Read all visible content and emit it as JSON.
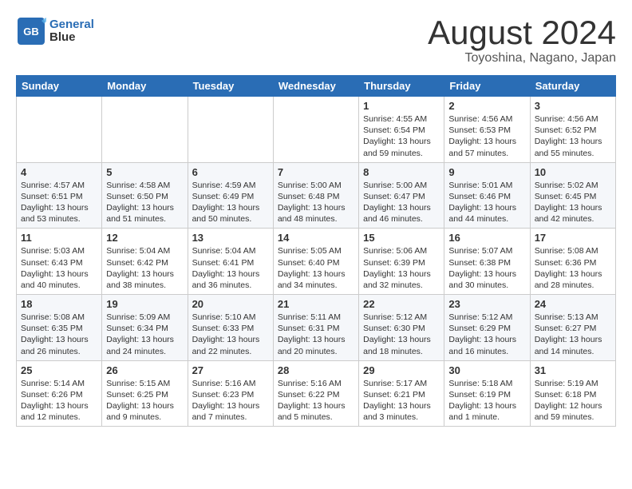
{
  "header": {
    "logo_line1": "General",
    "logo_line2": "Blue",
    "month_title": "August 2024",
    "location": "Toyoshina, Nagano, Japan"
  },
  "weekdays": [
    "Sunday",
    "Monday",
    "Tuesday",
    "Wednesday",
    "Thursday",
    "Friday",
    "Saturday"
  ],
  "weeks": [
    [
      {
        "day": "",
        "info": ""
      },
      {
        "day": "",
        "info": ""
      },
      {
        "day": "",
        "info": ""
      },
      {
        "day": "",
        "info": ""
      },
      {
        "day": "1",
        "info": "Sunrise: 4:55 AM\nSunset: 6:54 PM\nDaylight: 13 hours\nand 59 minutes."
      },
      {
        "day": "2",
        "info": "Sunrise: 4:56 AM\nSunset: 6:53 PM\nDaylight: 13 hours\nand 57 minutes."
      },
      {
        "day": "3",
        "info": "Sunrise: 4:56 AM\nSunset: 6:52 PM\nDaylight: 13 hours\nand 55 minutes."
      }
    ],
    [
      {
        "day": "4",
        "info": "Sunrise: 4:57 AM\nSunset: 6:51 PM\nDaylight: 13 hours\nand 53 minutes."
      },
      {
        "day": "5",
        "info": "Sunrise: 4:58 AM\nSunset: 6:50 PM\nDaylight: 13 hours\nand 51 minutes."
      },
      {
        "day": "6",
        "info": "Sunrise: 4:59 AM\nSunset: 6:49 PM\nDaylight: 13 hours\nand 50 minutes."
      },
      {
        "day": "7",
        "info": "Sunrise: 5:00 AM\nSunset: 6:48 PM\nDaylight: 13 hours\nand 48 minutes."
      },
      {
        "day": "8",
        "info": "Sunrise: 5:00 AM\nSunset: 6:47 PM\nDaylight: 13 hours\nand 46 minutes."
      },
      {
        "day": "9",
        "info": "Sunrise: 5:01 AM\nSunset: 6:46 PM\nDaylight: 13 hours\nand 44 minutes."
      },
      {
        "day": "10",
        "info": "Sunrise: 5:02 AM\nSunset: 6:45 PM\nDaylight: 13 hours\nand 42 minutes."
      }
    ],
    [
      {
        "day": "11",
        "info": "Sunrise: 5:03 AM\nSunset: 6:43 PM\nDaylight: 13 hours\nand 40 minutes."
      },
      {
        "day": "12",
        "info": "Sunrise: 5:04 AM\nSunset: 6:42 PM\nDaylight: 13 hours\nand 38 minutes."
      },
      {
        "day": "13",
        "info": "Sunrise: 5:04 AM\nSunset: 6:41 PM\nDaylight: 13 hours\nand 36 minutes."
      },
      {
        "day": "14",
        "info": "Sunrise: 5:05 AM\nSunset: 6:40 PM\nDaylight: 13 hours\nand 34 minutes."
      },
      {
        "day": "15",
        "info": "Sunrise: 5:06 AM\nSunset: 6:39 PM\nDaylight: 13 hours\nand 32 minutes."
      },
      {
        "day": "16",
        "info": "Sunrise: 5:07 AM\nSunset: 6:38 PM\nDaylight: 13 hours\nand 30 minutes."
      },
      {
        "day": "17",
        "info": "Sunrise: 5:08 AM\nSunset: 6:36 PM\nDaylight: 13 hours\nand 28 minutes."
      }
    ],
    [
      {
        "day": "18",
        "info": "Sunrise: 5:08 AM\nSunset: 6:35 PM\nDaylight: 13 hours\nand 26 minutes."
      },
      {
        "day": "19",
        "info": "Sunrise: 5:09 AM\nSunset: 6:34 PM\nDaylight: 13 hours\nand 24 minutes."
      },
      {
        "day": "20",
        "info": "Sunrise: 5:10 AM\nSunset: 6:33 PM\nDaylight: 13 hours\nand 22 minutes."
      },
      {
        "day": "21",
        "info": "Sunrise: 5:11 AM\nSunset: 6:31 PM\nDaylight: 13 hours\nand 20 minutes."
      },
      {
        "day": "22",
        "info": "Sunrise: 5:12 AM\nSunset: 6:30 PM\nDaylight: 13 hours\nand 18 minutes."
      },
      {
        "day": "23",
        "info": "Sunrise: 5:12 AM\nSunset: 6:29 PM\nDaylight: 13 hours\nand 16 minutes."
      },
      {
        "day": "24",
        "info": "Sunrise: 5:13 AM\nSunset: 6:27 PM\nDaylight: 13 hours\nand 14 minutes."
      }
    ],
    [
      {
        "day": "25",
        "info": "Sunrise: 5:14 AM\nSunset: 6:26 PM\nDaylight: 13 hours\nand 12 minutes."
      },
      {
        "day": "26",
        "info": "Sunrise: 5:15 AM\nSunset: 6:25 PM\nDaylight: 13 hours\nand 9 minutes."
      },
      {
        "day": "27",
        "info": "Sunrise: 5:16 AM\nSunset: 6:23 PM\nDaylight: 13 hours\nand 7 minutes."
      },
      {
        "day": "28",
        "info": "Sunrise: 5:16 AM\nSunset: 6:22 PM\nDaylight: 13 hours\nand 5 minutes."
      },
      {
        "day": "29",
        "info": "Sunrise: 5:17 AM\nSunset: 6:21 PM\nDaylight: 13 hours\nand 3 minutes."
      },
      {
        "day": "30",
        "info": "Sunrise: 5:18 AM\nSunset: 6:19 PM\nDaylight: 13 hours\nand 1 minute."
      },
      {
        "day": "31",
        "info": "Sunrise: 5:19 AM\nSunset: 6:18 PM\nDaylight: 12 hours\nand 59 minutes."
      }
    ]
  ]
}
